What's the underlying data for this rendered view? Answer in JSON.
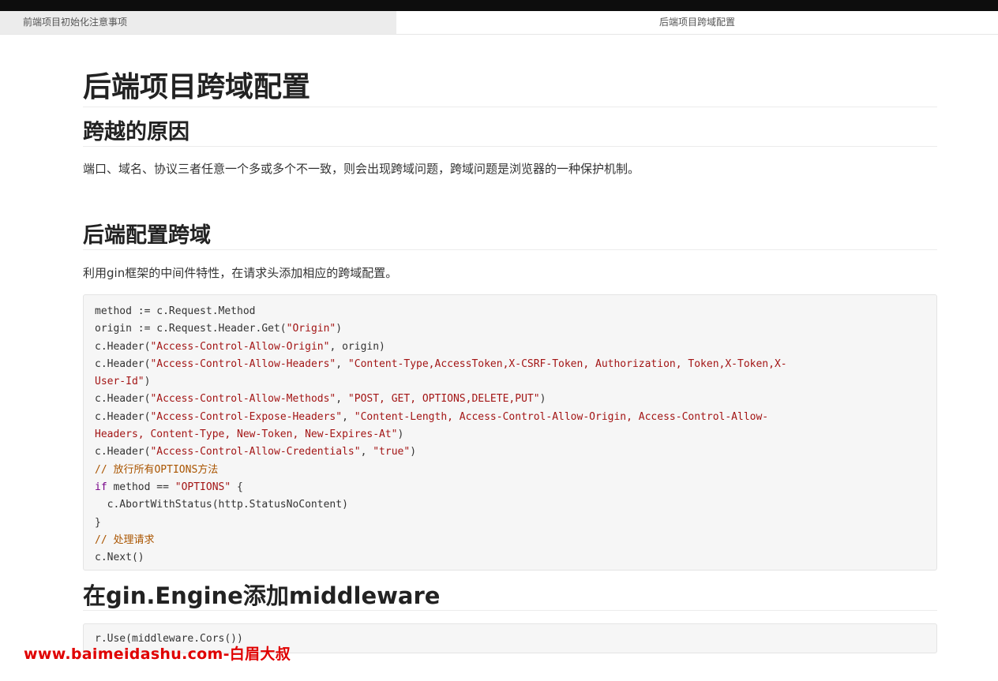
{
  "tabs": [
    {
      "label": "前端项目初始化注意事项",
      "active": false
    },
    {
      "label": "后端项目跨域配置",
      "active": true
    }
  ],
  "doc": {
    "title": "后端项目跨域配置",
    "sections": [
      {
        "heading": "跨越的原因",
        "paragraph": "端口、域名、协议三者任意一个多或多个不一致，则会出现跨域问题，跨域问题是浏览器的一种保护机制。"
      },
      {
        "heading": "后端配置跨域",
        "paragraph": "利用gin框架的中间件特性，在请求头添加相应的跨域配置。"
      },
      {
        "heading": "在gin.Engine添加middleware"
      }
    ]
  },
  "code1": {
    "l1": "method := c.Request.Method",
    "l2a": "origin := c.Request.Header.Get(",
    "l2s": "\"Origin\"",
    "l2b": ")",
    "l3a": "c.Header(",
    "l3s": "\"Access-Control-Allow-Origin\"",
    "l3b": ", origin)",
    "l4a": "c.Header(",
    "l4s1": "\"Access-Control-Allow-Headers\"",
    "l4m": ", ",
    "l4s2": "\"Content-Type,AccessToken,X-CSRF-Token, Authorization, Token,X-Token,X-",
    "l5s": "User-Id\"",
    "l5b": ")",
    "l6a": "c.Header(",
    "l6s1": "\"Access-Control-Allow-Methods\"",
    "l6m": ", ",
    "l6s2": "\"POST, GET, OPTIONS,DELETE,PUT\"",
    "l6b": ")",
    "l7a": "c.Header(",
    "l7s1": "\"Access-Control-Expose-Headers\"",
    "l7m": ", ",
    "l7s2": "\"Content-Length, Access-Control-Allow-Origin, Access-Control-Allow-",
    "l8s": "Headers, Content-Type, New-Token, New-Expires-At\"",
    "l8b": ")",
    "l9a": "c.Header(",
    "l9s1": "\"Access-Control-Allow-Credentials\"",
    "l9m": ", ",
    "l9s2": "\"true\"",
    "l9b": ")",
    "l10": "// 放行所有OPTIONS方法",
    "l11k": "if",
    "l11a": " method == ",
    "l11s": "\"OPTIONS\"",
    "l11b": " {",
    "l12": "  c.AbortWithStatus(http.StatusNoContent)",
    "l13": "}",
    "l14": "// 处理请求",
    "l15": "c.Next()"
  },
  "code2": {
    "l1": "r.Use(middleware.Cors())"
  },
  "watermark": "www.baimeidashu.com-白眉大叔",
  "colors": {
    "string": "#a31515",
    "keyword": "#770088",
    "comment": "#aa5500",
    "watermark": "#e00000"
  }
}
